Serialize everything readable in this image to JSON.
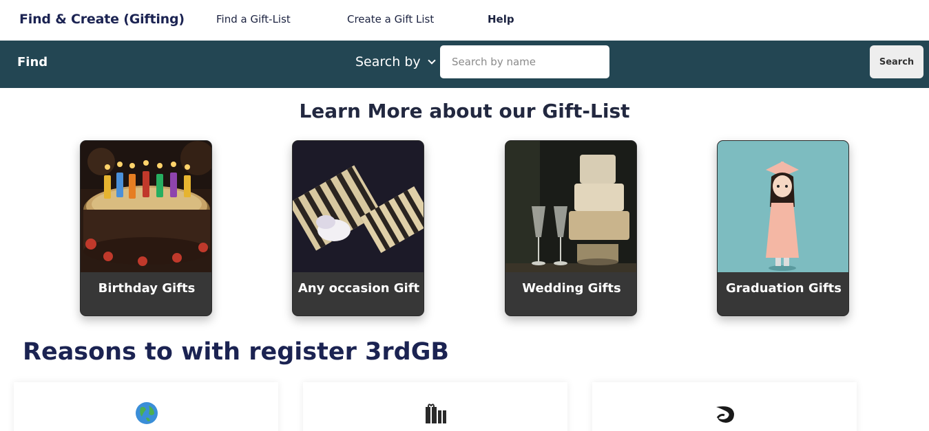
{
  "nav": {
    "brand": "Find & Create (Gifting)",
    "links": [
      "Find a Gift-List",
      "Create a Gift List",
      "Help"
    ]
  },
  "findbar": {
    "label": "Find",
    "search_by": "Search by",
    "search_placeholder": "Search by name",
    "search_button": "Search"
  },
  "learn": {
    "title": "Learn More about our Gift-List",
    "cards": [
      {
        "label": "Birthday Gifts"
      },
      {
        "label": "Any occasion Gift"
      },
      {
        "label": "Wedding Gifts"
      },
      {
        "label": "Graduation Gifts"
      }
    ]
  },
  "reasons": {
    "title": "Reasons to with register 3rdGB",
    "icons": [
      "globe-icon",
      "gifts-icon",
      "swoosh-icon"
    ]
  }
}
